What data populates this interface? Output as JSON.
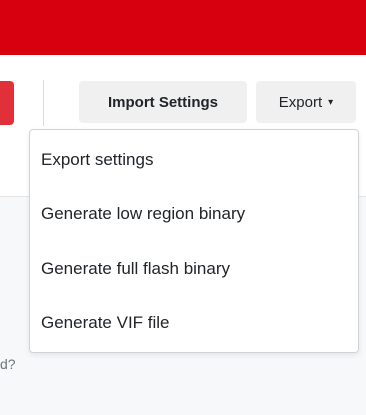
{
  "toolbar": {
    "import_label": "Import Settings",
    "export_label": "Export",
    "export_caret": "▾"
  },
  "dropdown": {
    "items": [
      {
        "label": "Export settings"
      },
      {
        "label": "Generate low region binary"
      },
      {
        "label": "Generate full flash binary"
      },
      {
        "label": "Generate VIF file"
      }
    ]
  },
  "background": {
    "fragment_text": "d?"
  },
  "colors": {
    "brand_red": "#d6000f",
    "button_bg": "#f0f0f0",
    "menu_border": "#d0d4d8",
    "text": "#212529"
  }
}
